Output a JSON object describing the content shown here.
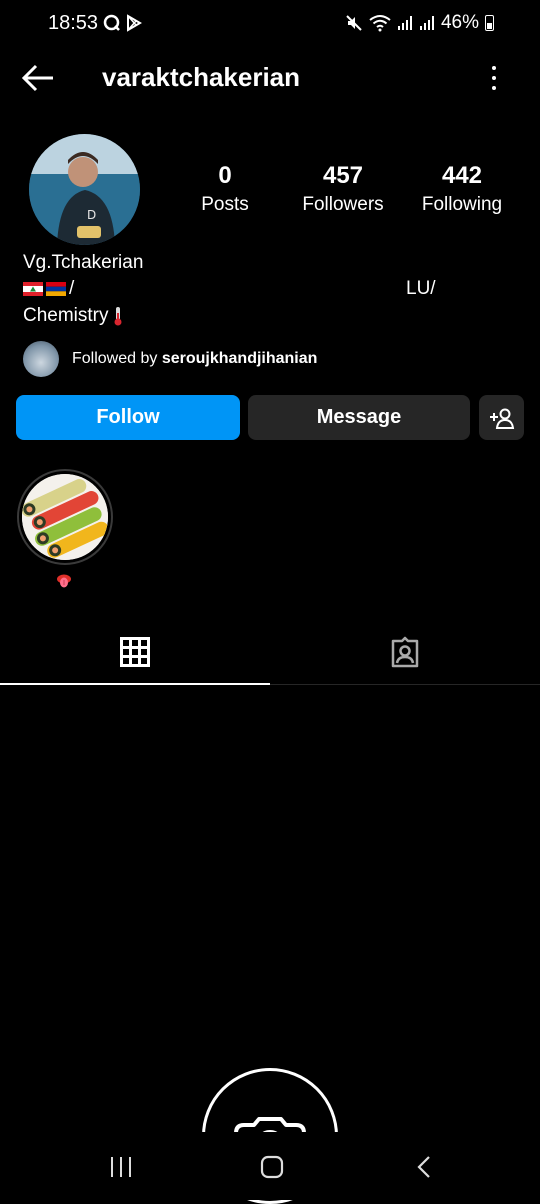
{
  "status_bar": {
    "time": "18:53",
    "battery": "46%",
    "icons": [
      "q-app-icon",
      "play-store-icon",
      "mute-icon",
      "wifi-icon",
      "signal-icon",
      "signal-icon",
      "battery-icon"
    ]
  },
  "header": {
    "username": "varaktchakerian",
    "back_icon": "back-arrow-icon",
    "more_icon": "more-vertical-icon"
  },
  "stats": {
    "posts": {
      "count": "0",
      "label": "Posts"
    },
    "followers": {
      "count": "457",
      "label": "Followers"
    },
    "following": {
      "count": "442",
      "label": "Following"
    }
  },
  "bio": {
    "name": "Vg.Tchakerian",
    "line1_text": "/",
    "line1_right": "LU/",
    "line2": "Chemistry"
  },
  "followed_by": {
    "prefix": "Followed by ",
    "user": "seroujkhandjihanian"
  },
  "buttons": {
    "follow": "Follow",
    "message": "Message"
  },
  "colors": {
    "accent": "#0095f6",
    "button_bg": "#262626",
    "background": "#000000"
  },
  "tabs": [
    "grid-icon",
    "tagged-icon"
  ]
}
